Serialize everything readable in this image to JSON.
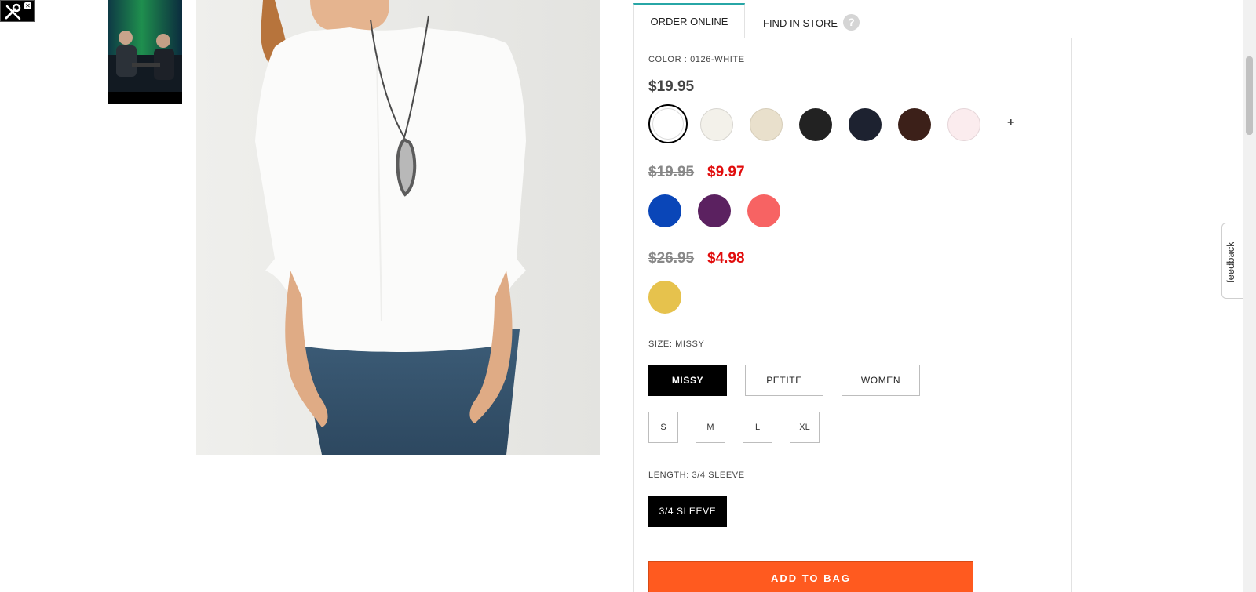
{
  "tabs": {
    "order_online": "ORDER ONLINE",
    "find_in_store": "FIND IN STORE",
    "help": "?"
  },
  "color": {
    "label": "COLOR : 0126-WHITE"
  },
  "price_groups": [
    {
      "price": "$19.95",
      "swatches": [
        "#ffffff",
        "#f3f1ea",
        "#e9e0cc",
        "#222222",
        "#1d2230",
        "#3c2019",
        "#fbecee"
      ]
    },
    {
      "orig_price": "$19.95",
      "sale_price": "$9.97",
      "swatches": [
        "#0a46b8",
        "#5b2160",
        "#f76363"
      ]
    },
    {
      "orig_price": "$26.95",
      "sale_price": "$4.98",
      "swatches": [
        "#e6c24d"
      ]
    }
  ],
  "more_colors": "+",
  "size": {
    "label_prefix": "SIZE:",
    "label_value": "MISSY",
    "types": [
      "MISSY",
      "PETITE",
      "WOMEN"
    ],
    "sizes": [
      "S",
      "M",
      "L",
      "XL"
    ]
  },
  "length": {
    "label_prefix": "LENGTH:",
    "label_value": "3/4 SLEEVE",
    "option": "3/4 SLEEVE"
  },
  "add_to_bag": "ADD TO BAG",
  "feedback": "feedback",
  "colors": {
    "accent_tab": "#27a6a6",
    "sale": "#e10d0d",
    "cta": "#ff5a1f"
  }
}
